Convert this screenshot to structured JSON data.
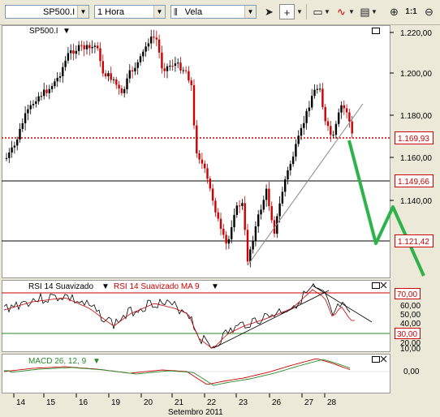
{
  "toolbar": {
    "symbol": "SP500.I",
    "timeframe": "1 Hora",
    "chart_style": "Vela",
    "cursor_icon": "cursor-arrow-icon",
    "crosshair_icon": "crosshair-icon",
    "indicator_icon": "indicator-wave-icon",
    "drawing_icon": "drawing-tool-icon",
    "zoom_fit_label": "1:1"
  },
  "panels": {
    "price": {
      "title": "SP500.I"
    },
    "rsi": {
      "title": "RSI 14 Suavizado",
      "ma_title": "RSI 14 Suavizado MA 9"
    },
    "macd": {
      "title": "MACD 26, 12, 9"
    }
  },
  "price_labels": {
    "axis": [
      "1.220,00",
      "1.200,00",
      "1.180,00",
      "1.160,00",
      "1.140,00"
    ],
    "current": "1.169,93",
    "level1": "1.149,66",
    "level2": "1.121,42"
  },
  "rsi_labels": {
    "axis": [
      "60,00",
      "50,00",
      "40,00",
      "20,00",
      "10,00"
    ],
    "upper": "70,00",
    "lower": "30,00"
  },
  "macd_labels": {
    "zero": "0,00"
  },
  "x_axis": {
    "days": [
      "14",
      "15",
      "16",
      "19",
      "20",
      "21",
      "22",
      "23",
      "26",
      "27",
      "28"
    ],
    "month": "Setembro 2011"
  },
  "colors": {
    "up_candle": "#000000",
    "down_candle": "#cc0000",
    "resistance_line": "#cc0000",
    "forecast_arrow": "#2db34a",
    "rsi_line": "#000000",
    "rsi_ma_line": "#cc0000",
    "macd_line": "#cc0000",
    "signal_line": "#2a8a2a",
    "upper_band": "#cc0000",
    "lower_band": "#2a8a2a"
  }
}
